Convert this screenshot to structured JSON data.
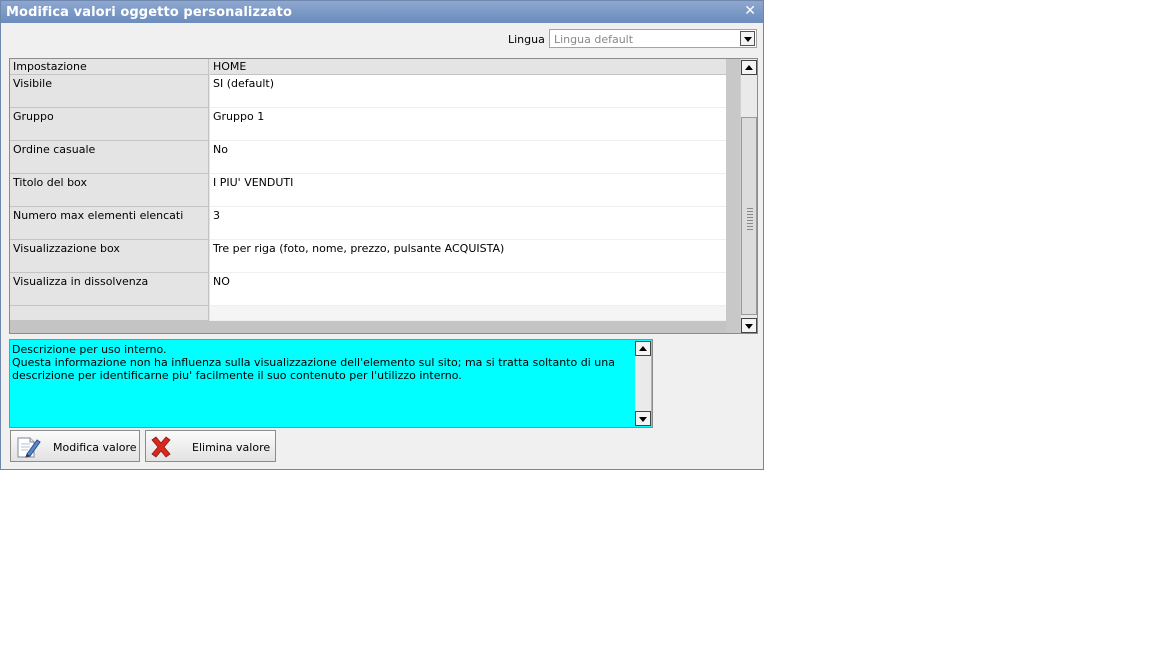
{
  "window": {
    "title": "Modifica valori oggetto personalizzato"
  },
  "language": {
    "label": "Lingua :",
    "selected": "Lingua default"
  },
  "grid": {
    "header": {
      "label": "Impostazione",
      "value": "HOME"
    },
    "rows": [
      {
        "label": "Visibile",
        "value": "SI (default)"
      },
      {
        "label": "Gruppo",
        "value": "Gruppo 1"
      },
      {
        "label": "Ordine casuale",
        "value": "No"
      },
      {
        "label": "Titolo del box",
        "value": "I PIU' VENDUTI"
      },
      {
        "label": "Numero max elementi elencati",
        "value": "3"
      },
      {
        "label": "Visualizzazione box",
        "value": "Tre per riga (foto, nome, prezzo, pulsante ACQUISTA)"
      },
      {
        "label": "Visualizza in dissolvenza",
        "value": "NO"
      }
    ]
  },
  "description": {
    "text": "Descrizione per uso interno.\nQuesta informazione non ha influenza sulla visualizzazione dell'elemento sul sito; ma si tratta soltanto di una descrizione per identificarne piu' facilmente il suo contenuto per l'utilizzo interno."
  },
  "buttons": {
    "edit": "Modifica valore",
    "delete": "Elimina valore"
  },
  "icons": {
    "edit": "edit-document-icon",
    "delete": "red-x-icon",
    "close": "close-icon"
  },
  "colors": {
    "description_bg": "#00ffff",
    "titlebar": "#7a97c6",
    "delete_icon": "#d9281e"
  }
}
